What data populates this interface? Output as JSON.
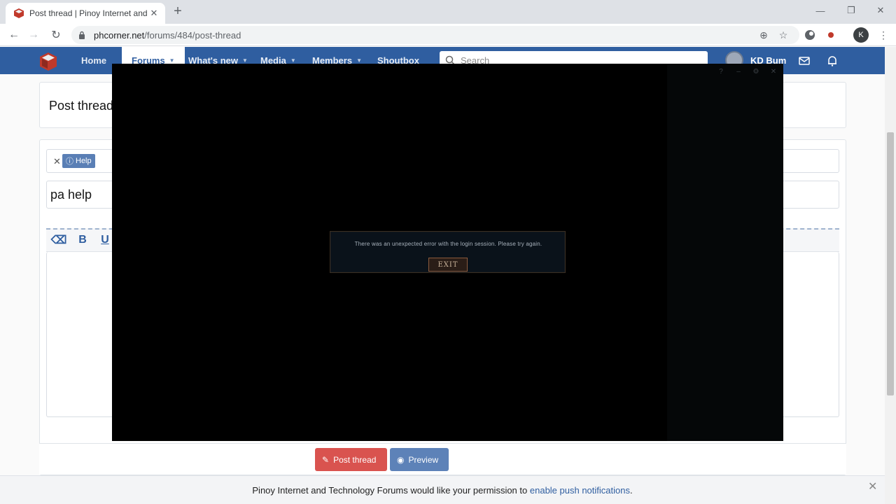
{
  "browser": {
    "tab_title": "Post thread | Pinoy Internet and T",
    "new_tab_symbol": "+",
    "url_host": "phcorner.net",
    "url_path": "/forums/484/post-thread",
    "profile_initial": "K"
  },
  "site_nav": {
    "items": [
      {
        "label": "Home"
      },
      {
        "label": "Forums"
      },
      {
        "label": "What's new"
      },
      {
        "label": "Media"
      },
      {
        "label": "Members"
      },
      {
        "label": "Shoutbox"
      }
    ],
    "search_placeholder": "Search",
    "username": "KD Bum"
  },
  "page": {
    "title": "Post thread",
    "prefix_tag": "Help",
    "thread_title_value": "pa help",
    "buttons": {
      "post": "Post thread",
      "preview": "Preview"
    }
  },
  "push_bar": {
    "text": "Pinoy Internet and Technology Forums would like your permission to",
    "link": "enable push notifications",
    "suffix": "."
  },
  "overlay": {
    "message": "There was an unexpected error with the login session. Please try again.",
    "exit_label": "EXIT"
  }
}
